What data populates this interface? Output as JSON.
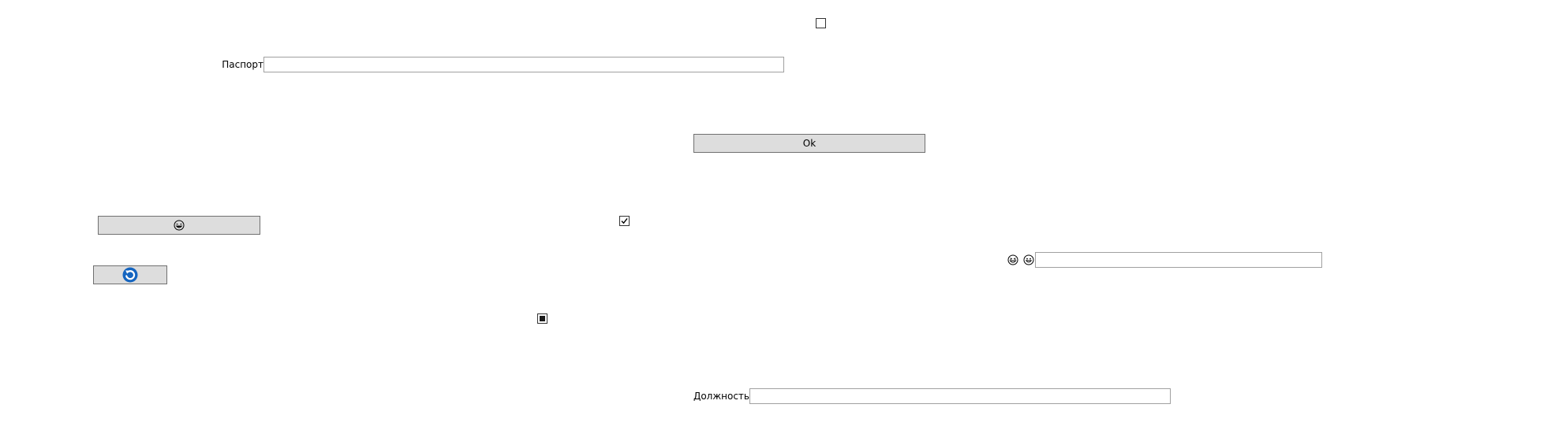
{
  "checkbox_top": {
    "checked": false
  },
  "passport": {
    "label": "Паспорт",
    "value": ""
  },
  "ok_button": {
    "label": "Ok"
  },
  "emoji_button": {
    "icon": "grinning-face-icon"
  },
  "checkbox_middle": {
    "checked": true
  },
  "refresh_button": {
    "icon": "refresh-icon",
    "color": "#1565c0"
  },
  "emoji_field": {
    "icons": [
      "grinning-squinting-face-icon",
      "smiling-face-icon"
    ],
    "value": ""
  },
  "checkbox_lower": {
    "state": "indeterminate"
  },
  "position": {
    "label": "Должность",
    "value": ""
  }
}
